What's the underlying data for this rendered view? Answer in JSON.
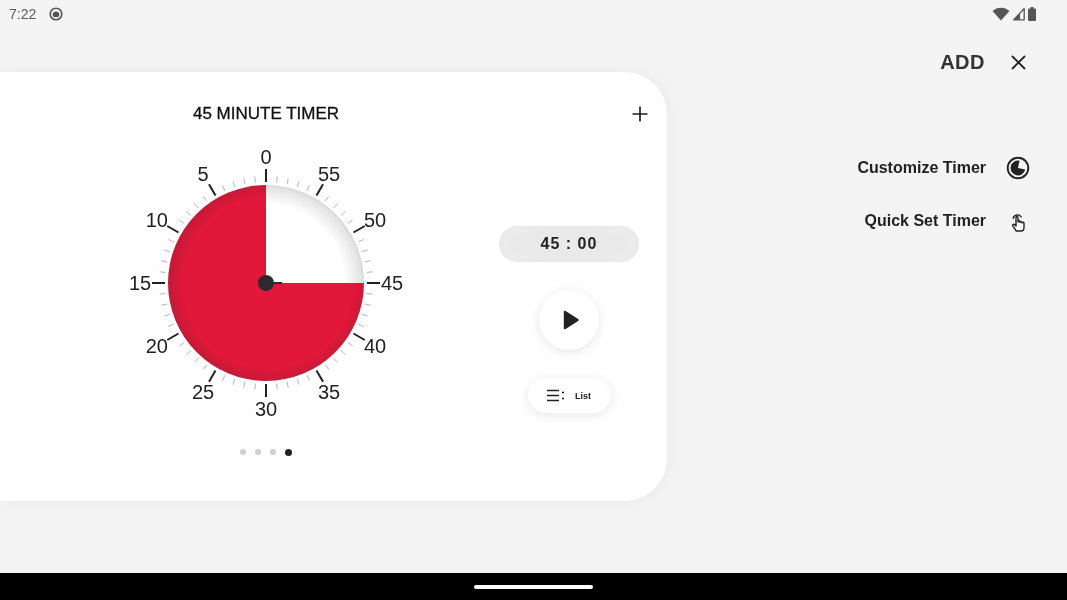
{
  "status_bar": {
    "time": "7:22"
  },
  "timer_card": {
    "title": "45 MINUTE TIMER",
    "dial": {
      "labels": [
        "0",
        "55",
        "50",
        "45",
        "40",
        "35",
        "30",
        "25",
        "20",
        "15",
        "10",
        "5"
      ],
      "chart_data": {
        "type": "pie",
        "values": [
          25,
          75
        ]
      }
    },
    "time_display": "45 : 00",
    "list_button": {
      "label": "List"
    },
    "pages": [
      {
        "selected": false
      },
      {
        "selected": false
      },
      {
        "selected": false
      },
      {
        "selected": true
      }
    ]
  },
  "panel": {
    "add_label": "ADD",
    "items": [
      {
        "label": "Customize Timer",
        "kind": "customize"
      },
      {
        "label": "Quick Set Timer",
        "kind": "quick-set"
      }
    ]
  }
}
